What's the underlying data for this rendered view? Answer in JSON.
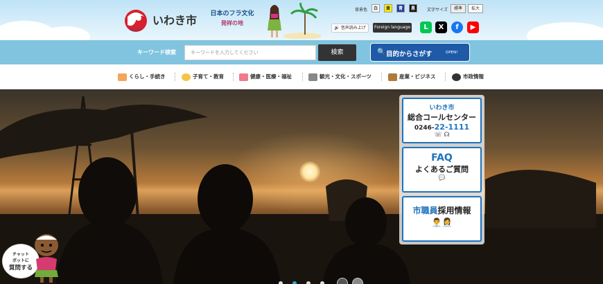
{
  "header": {
    "logo_text": "いわき市",
    "banner": {
      "line1": "日本のフラ文化",
      "line2": "発祥の地"
    },
    "bg_color": {
      "label": "背景色",
      "options": [
        "白",
        "黄",
        "青",
        "黒"
      ]
    },
    "font_size": {
      "label": "文字サイズ",
      "options": [
        "標準",
        "拡大"
      ]
    },
    "voice_label": "音声読み上げ",
    "foreign_label": "Foreign language",
    "social": [
      "LINE",
      "X",
      "Facebook",
      "YouTube"
    ]
  },
  "search": {
    "label": "キーワード検索",
    "placeholder": "キーワードを入力してください",
    "button": "検索",
    "purpose_label": "目的からさがす",
    "purpose_badge": "OPEN!"
  },
  "nav": {
    "items": [
      "くらし・手続き",
      "子育て・教育",
      "健康・医療・福祉",
      "観光・文化・スポーツ",
      "産業・ビジネス",
      "市政情報"
    ]
  },
  "side": {
    "call_center": {
      "city": "いわき市",
      "title": "総合コールセンター",
      "tel_prefix": "0246-",
      "tel_main": "22-1111"
    },
    "faq": {
      "title": "FAQ",
      "subtitle": "よくあるご質問"
    },
    "recruit": {
      "part1": "市職員",
      "part2": "採用情報"
    }
  },
  "chatbot": {
    "line1": "チャット",
    "line2": "ボットに",
    "line3": "質問する"
  },
  "colors": {
    "nav_bar": "#81c4df",
    "purpose_button": "#1e5aa8",
    "card_border": "#1e73be"
  }
}
